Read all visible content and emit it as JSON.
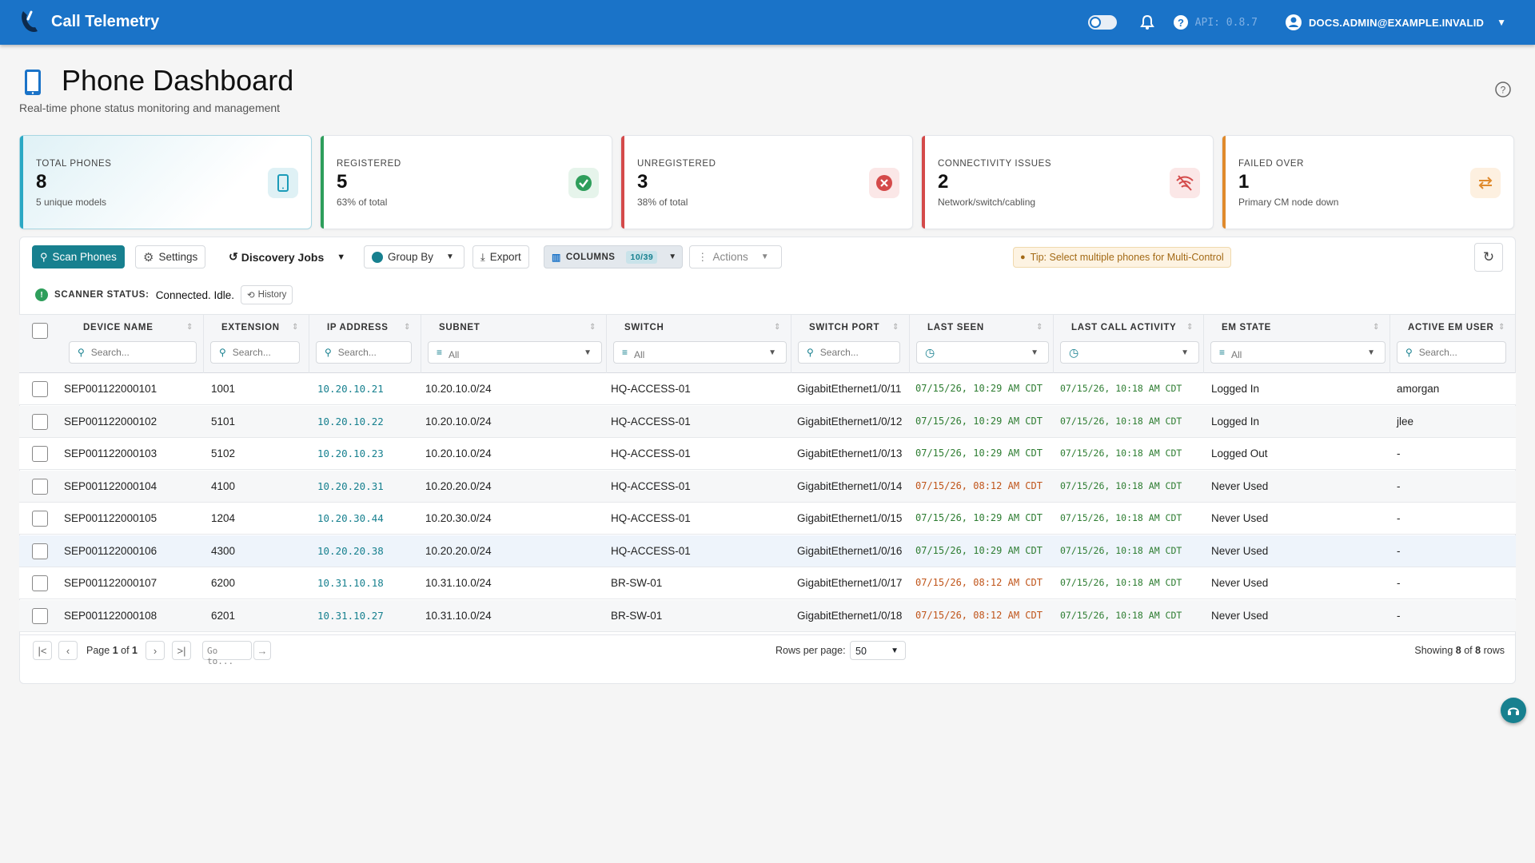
{
  "app": {
    "title": "Call Telemetry",
    "api": "API: 0.8.7",
    "user": "DOCS.ADMIN@EXAMPLE.INVALID"
  },
  "page": {
    "title": "Phone Dashboard",
    "subtitle": "Real-time phone status monitoring and management"
  },
  "cards": [
    {
      "label": "TOTAL PHONES",
      "value": "8",
      "sub": "5 unique models",
      "color": "#2aa8c4",
      "icon": "phone-icon"
    },
    {
      "label": "REGISTERED",
      "value": "5",
      "sub": "63% of total",
      "color": "#2e9e5b",
      "icon": "check-circle-icon"
    },
    {
      "label": "UNREGISTERED",
      "value": "3",
      "sub": "38% of total",
      "color": "#d44a4a",
      "icon": "x-circle-icon"
    },
    {
      "label": "CONNECTIVITY ISSUES",
      "value": "2",
      "sub": "Network/switch/cabling",
      "color": "#d44a4a",
      "icon": "wifi-off-icon"
    },
    {
      "label": "FAILED OVER",
      "value": "1",
      "sub": "Primary CM node down",
      "color": "#e08a2c",
      "icon": "swap-icon"
    }
  ],
  "toolbar": {
    "scan": "Scan Phones",
    "settings": "Settings",
    "discovery": "Discovery Jobs",
    "group_by": "Group By",
    "export": "Export",
    "columns": "COLUMNS",
    "columns_count": "10/39",
    "actions": "Actions",
    "tip": "Tip: Select multiple phones for Multi-Control"
  },
  "scanner": {
    "label": "SCANNER STATUS:",
    "value": "Connected. Idle.",
    "history": "History"
  },
  "columns": [
    {
      "label": "DEVICE NAME",
      "filter": "Search...",
      "kind": "search"
    },
    {
      "label": "EXTENSION",
      "filter": "Search...",
      "kind": "search"
    },
    {
      "label": "IP ADDRESS",
      "filter": "Search...",
      "kind": "search"
    },
    {
      "label": "SUBNET",
      "filter": "All",
      "kind": "select"
    },
    {
      "label": "SWITCH",
      "filter": "All",
      "kind": "select"
    },
    {
      "label": "SWITCH PORT",
      "filter": "Search...",
      "kind": "search"
    },
    {
      "label": "LAST SEEN",
      "filter": "",
      "kind": "time"
    },
    {
      "label": "LAST CALL ACTIVITY",
      "filter": "",
      "kind": "time"
    },
    {
      "label": "EM STATE",
      "filter": "All",
      "kind": "select"
    },
    {
      "label": "ACTIVE EM USER",
      "filter": "Search...",
      "kind": "search"
    }
  ],
  "rows": [
    {
      "device": "SEP001122000101",
      "ext": "1001",
      "ip": "10.20.10.21",
      "subnet": "10.20.10.0/24",
      "switch": "HQ-ACCESS-01",
      "port": "GigabitEthernet1/0/11",
      "seen": "07/15/26, 10:29 AM CDT",
      "seen_status": "ok",
      "call": "07/15/26, 10:18 AM CDT",
      "em": "Logged In",
      "user": "amorgan"
    },
    {
      "device": "SEP001122000102",
      "ext": "5101",
      "ip": "10.20.10.22",
      "subnet": "10.20.10.0/24",
      "switch": "HQ-ACCESS-01",
      "port": "GigabitEthernet1/0/12",
      "seen": "07/15/26, 10:29 AM CDT",
      "seen_status": "ok",
      "call": "07/15/26, 10:18 AM CDT",
      "em": "Logged In",
      "user": "jlee"
    },
    {
      "device": "SEP001122000103",
      "ext": "5102",
      "ip": "10.20.10.23",
      "subnet": "10.20.10.0/24",
      "switch": "HQ-ACCESS-01",
      "port": "GigabitEthernet1/0/13",
      "seen": "07/15/26, 10:29 AM CDT",
      "seen_status": "ok",
      "call": "07/15/26, 10:18 AM CDT",
      "em": "Logged Out",
      "user": "-"
    },
    {
      "device": "SEP001122000104",
      "ext": "4100",
      "ip": "10.20.20.31",
      "subnet": "10.20.20.0/24",
      "switch": "HQ-ACCESS-01",
      "port": "GigabitEthernet1/0/14",
      "seen": "07/15/26, 08:12 AM CDT",
      "seen_status": "stale",
      "call": "07/15/26, 10:18 AM CDT",
      "em": "Never Used",
      "user": "-"
    },
    {
      "device": "SEP001122000105",
      "ext": "1204",
      "ip": "10.20.30.44",
      "subnet": "10.20.30.0/24",
      "switch": "HQ-ACCESS-01",
      "port": "GigabitEthernet1/0/15",
      "seen": "07/15/26, 10:29 AM CDT",
      "seen_status": "ok",
      "call": "07/15/26, 10:18 AM CDT",
      "em": "Never Used",
      "user": "-"
    },
    {
      "device": "SEP001122000106",
      "ext": "4300",
      "ip": "10.20.20.38",
      "subnet": "10.20.20.0/24",
      "switch": "HQ-ACCESS-01",
      "port": "GigabitEthernet1/0/16",
      "seen": "07/15/26, 10:29 AM CDT",
      "seen_status": "ok",
      "call": "07/15/26, 10:18 AM CDT",
      "em": "Never Used",
      "user": "-"
    },
    {
      "device": "SEP001122000107",
      "ext": "6200",
      "ip": "10.31.10.18",
      "subnet": "10.31.10.0/24",
      "switch": "BR-SW-01",
      "port": "GigabitEthernet1/0/17",
      "seen": "07/15/26, 08:12 AM CDT",
      "seen_status": "stale",
      "call": "07/15/26, 10:18 AM CDT",
      "em": "Never Used",
      "user": "-"
    },
    {
      "device": "SEP001122000108",
      "ext": "6201",
      "ip": "10.31.10.27",
      "subnet": "10.31.10.0/24",
      "switch": "BR-SW-01",
      "port": "GigabitEthernet1/0/18",
      "seen": "07/15/26, 08:12 AM CDT",
      "seen_status": "stale",
      "call": "07/15/26, 10:18 AM CDT",
      "em": "Never Used",
      "user": "-"
    }
  ],
  "pagination": {
    "page": "Page",
    "current": "1",
    "of": "of",
    "total": "1",
    "goto": "Go to...",
    "rows_label": "Rows per page:",
    "rows_value": "50",
    "showing": "Showing",
    "shown": "8",
    "of2": "of",
    "count": "8",
    "rows": "rows"
  },
  "colors": {
    "primary": "#1a73c8",
    "teal": "#17808f",
    "ok_green": "#2e7d32",
    "stale_orange": "#c0551a"
  }
}
